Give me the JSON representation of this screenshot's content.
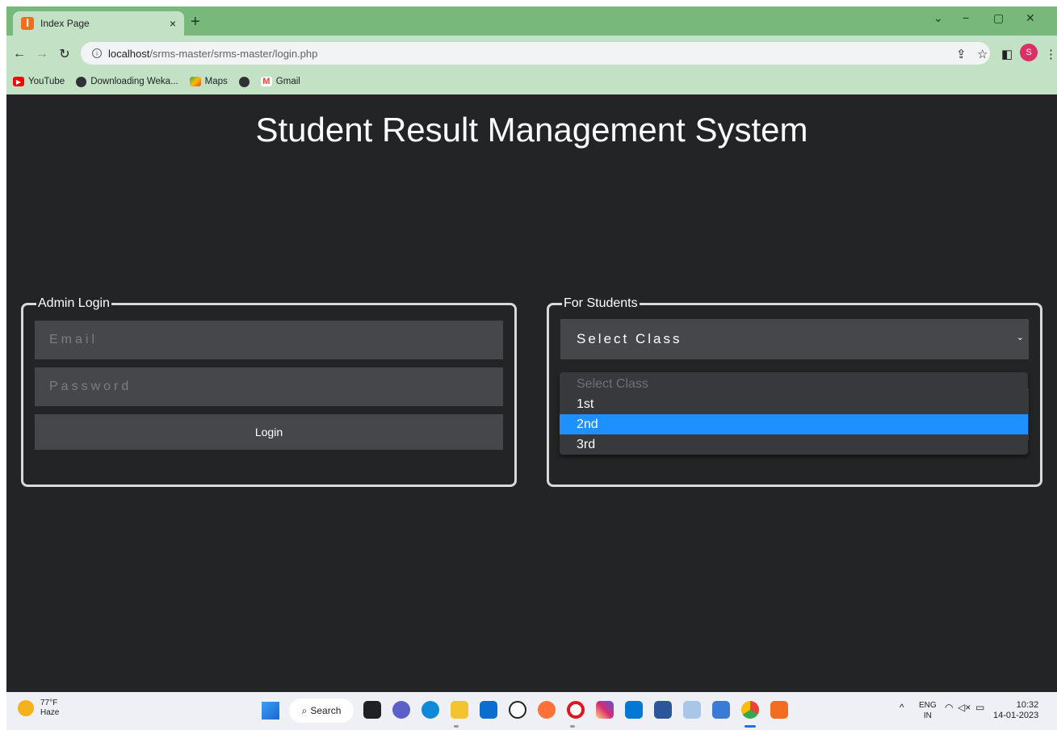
{
  "browser": {
    "tab_title": "Index Page",
    "tab_close": "×",
    "new_tab": "+",
    "url_host": "localhost",
    "url_path": "/srms-master/srms-master/login.php",
    "profile_initial": "S",
    "bookmarks": [
      {
        "label": "YouTube",
        "icon": "youtube-icon"
      },
      {
        "label": "Downloading Weka...",
        "icon": "globe-icon"
      },
      {
        "label": "Maps",
        "icon": "maps-icon"
      },
      {
        "label": "",
        "icon": "globe-icon"
      },
      {
        "label": "Gmail",
        "icon": "gmail-icon"
      }
    ]
  },
  "page": {
    "title": "Student Result Management System",
    "admin": {
      "legend": "Admin Login",
      "email_placeholder": "Email",
      "password_placeholder": "Password",
      "login_label": "Login"
    },
    "students": {
      "legend": "For Students",
      "select_value": "Select Class",
      "options": [
        "Select Class",
        "1st",
        "2nd",
        "3rd"
      ],
      "highlighted_option": "2nd"
    }
  },
  "taskbar": {
    "weather_temp": "77°F",
    "weather_desc": "Haze",
    "search_label": "Search",
    "lang_top": "ENG",
    "lang_bottom": "IN",
    "time": "10:32",
    "date": "14-01-2023"
  },
  "colors": {
    "page_bg": "#222426",
    "field_bg": "#45474b",
    "highlight": "#1e90ff",
    "tabstrip": "#79b87b",
    "toolbar": "#c3e2c5"
  }
}
